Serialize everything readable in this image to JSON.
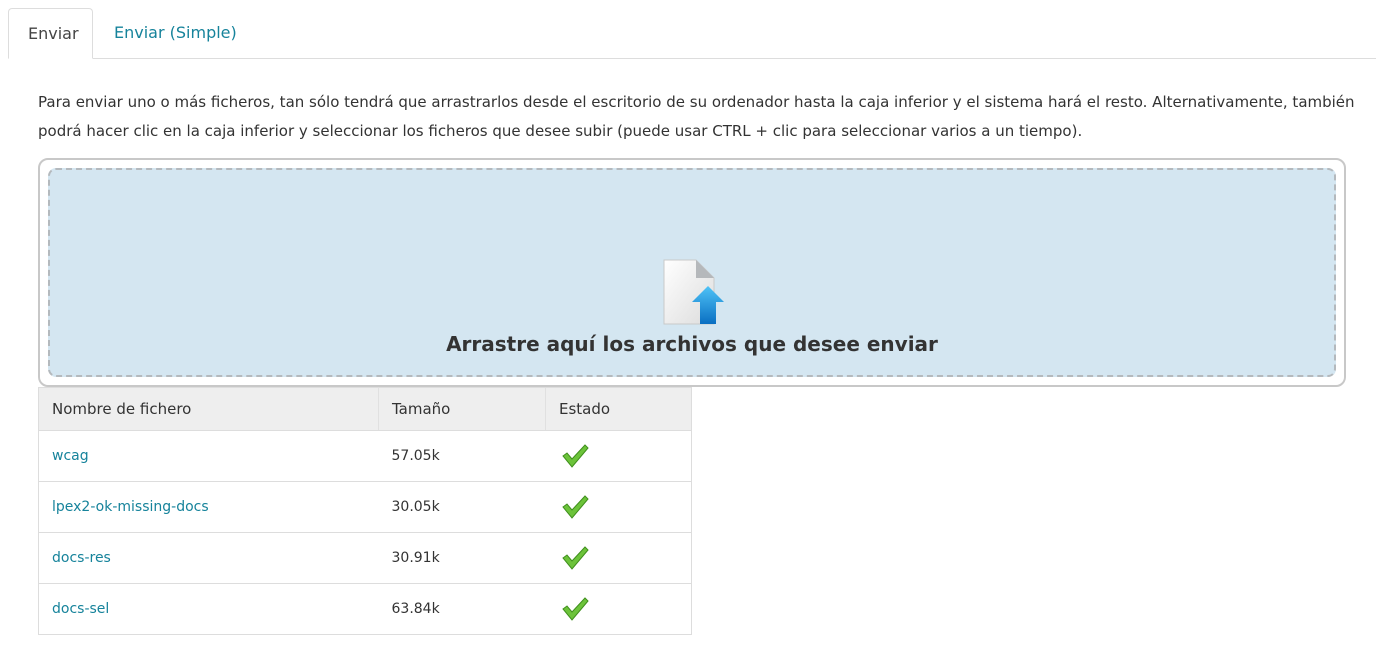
{
  "tabs": [
    {
      "label": "Enviar",
      "active": true
    },
    {
      "label": "Enviar (Simple)",
      "active": false
    }
  ],
  "intro_text": "Para enviar uno o más ficheros, tan sólo tendrá que arrastrarlos desde el escritorio de su ordenador hasta la caja inferior y el sistema hará el resto. Alternativamente, también podrá hacer clic en la caja inferior y seleccionar los ficheros que desee subir (puede usar CTRL + clic para seleccionar varios a un tiempo).",
  "dropzone": {
    "label": "Arrastre aquí los archivos que desee enviar",
    "icon": "file-upload-icon"
  },
  "table": {
    "headers": [
      "Nombre de fichero",
      "Tamaño",
      "Estado"
    ],
    "rows": [
      {
        "name": "wcag",
        "size": "57.05k",
        "status": "check-icon"
      },
      {
        "name": "lpex2-ok-missing-docs",
        "size": "30.05k",
        "status": "check-icon"
      },
      {
        "name": "docs-res",
        "size": "30.91k",
        "status": "check-icon"
      },
      {
        "name": "docs-sel",
        "size": "63.84k",
        "status": "check-icon"
      }
    ]
  },
  "colors": {
    "link": "#16839b",
    "dropzone_bg": "#d4e6f1",
    "check": "#5cb82e"
  }
}
